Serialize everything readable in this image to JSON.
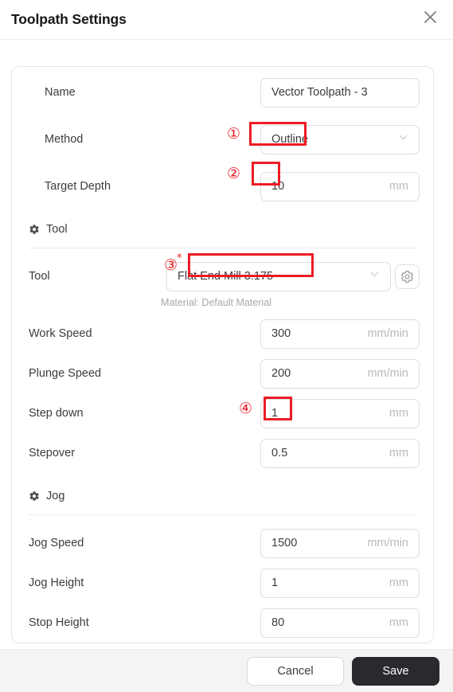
{
  "header": {
    "title": "Toolpath Settings",
    "close_icon": "close-icon"
  },
  "form": {
    "name": {
      "label": "Name",
      "value": "Vector Toolpath - 3"
    },
    "method": {
      "label": "Method",
      "value": "Outline",
      "chevron_icon": "chevron-down-icon",
      "annotation": "①"
    },
    "target_depth": {
      "label": "Target Depth",
      "value": "10",
      "unit": "mm",
      "annotation": "②"
    },
    "tool_section": {
      "title": "Tool",
      "icon": "gear-icon"
    },
    "tool": {
      "label": "Tool",
      "value": "Flat End Mill 3.175",
      "chevron_icon": "chevron-down-icon",
      "settings_icon": "gear-icon",
      "annotation": "③",
      "annotation_star": "*"
    },
    "material_note": "Material: Default Material",
    "work_speed": {
      "label": "Work Speed",
      "value": "300",
      "unit": "mm/min"
    },
    "plunge_speed": {
      "label": "Plunge Speed",
      "value": "200",
      "unit": "mm/min"
    },
    "step_down": {
      "label": "Step down",
      "value": "1",
      "unit": "mm",
      "annotation": "④"
    },
    "stepover": {
      "label": "Stepover",
      "value": "0.5",
      "unit": "mm"
    },
    "jog_section": {
      "title": "Jog",
      "icon": "gear-icon"
    },
    "jog_speed": {
      "label": "Jog Speed",
      "value": "1500",
      "unit": "mm/min"
    },
    "jog_height": {
      "label": "Jog Height",
      "value": "1",
      "unit": "mm"
    },
    "stop_height": {
      "label": "Stop Height",
      "value": "80",
      "unit": "mm"
    }
  },
  "footer": {
    "cancel_label": "Cancel",
    "save_label": "Save"
  },
  "colors": {
    "annotation_red": "#ec1c24",
    "save_button": "#292a2d",
    "footer_background": "#f4f4f5"
  }
}
